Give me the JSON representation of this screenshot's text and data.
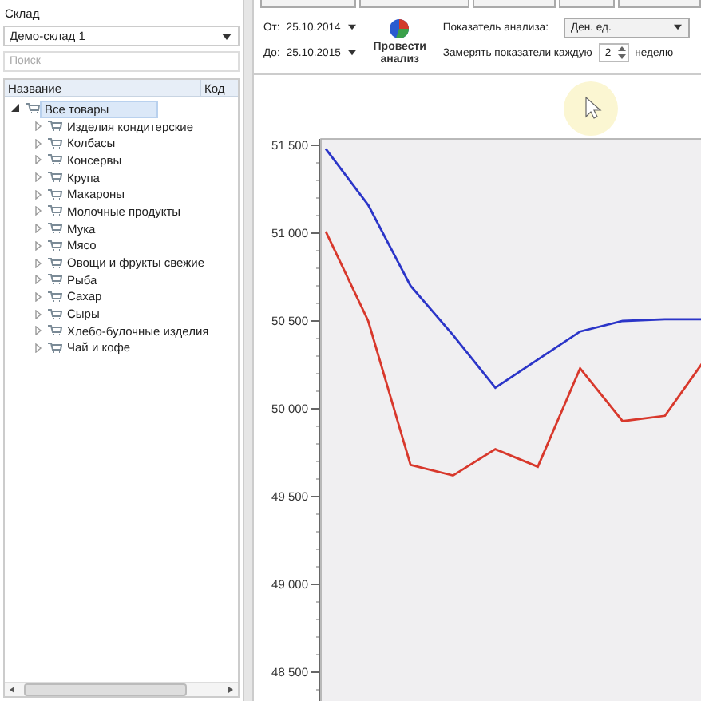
{
  "sidebar": {
    "warehouse_label": "Склад",
    "warehouse": "Демо-склад 1",
    "search": {
      "placeholder": "Поиск"
    },
    "columns": [
      "Название",
      "Код"
    ],
    "tree": [
      {
        "label": "Все товары",
        "expanded": true,
        "selected": true,
        "children": [
          {
            "label": "Изделия кондитерские",
            "expanded": false,
            "selected": false
          },
          {
            "label": "Колбасы",
            "expanded": false,
            "selected": false
          },
          {
            "label": "Консервы",
            "expanded": false,
            "selected": false
          },
          {
            "label": "Крупа",
            "expanded": false,
            "selected": false
          },
          {
            "label": "Макароны",
            "expanded": false,
            "selected": false
          },
          {
            "label": "Молочные продукты",
            "expanded": false,
            "selected": false
          },
          {
            "label": "Мука",
            "expanded": false,
            "selected": false
          },
          {
            "label": "Мясо",
            "expanded": false,
            "selected": false
          },
          {
            "label": "Овощи и фрукты свежие",
            "expanded": false,
            "selected": false
          },
          {
            "label": "Рыба",
            "expanded": false,
            "selected": false
          },
          {
            "label": "Сахар",
            "expanded": false,
            "selected": false
          },
          {
            "label": "Сыры",
            "expanded": false,
            "selected": false
          },
          {
            "label": "Хлебо-булочные изделия",
            "expanded": false,
            "selected": false
          },
          {
            "label": "Чай и кофе",
            "expanded": false,
            "selected": false
          }
        ]
      }
    ]
  },
  "toolbar": {
    "from_label": "От:",
    "from_date": "25.10.2014",
    "to_label": "До:",
    "to_date": "25.10.2015",
    "analyze_button": "Провести анализ",
    "indicator_label": "Показатель анализа:",
    "indicator": "Ден. ед.",
    "interval_label": "Замерять показатели каждую",
    "interval": "2",
    "interval_unit": "неделю"
  },
  "chart": {
    "chart_data": {
      "type": "line",
      "categories": [
        null,
        null,
        null,
        null,
        null,
        null,
        null,
        null,
        null,
        null
      ],
      "ylim": [
        48340,
        51550
      ],
      "yticks": [
        {
          "value": 48500,
          "label": "48 500"
        },
        {
          "value": 49000,
          "label": "49 000"
        },
        {
          "value": 49500,
          "label": "49 500"
        },
        {
          "value": 50000,
          "label": "50 000"
        },
        {
          "value": 50500,
          "label": "50 500"
        },
        {
          "value": 51000,
          "label": "51 000"
        },
        {
          "value": 51500,
          "label": "51 500"
        }
      ],
      "series": [
        {
          "color": "#2b35c8",
          "values": [
            51480,
            51160,
            50700,
            50420,
            50120,
            50280,
            50440,
            50500,
            50510,
            50510
          ]
        },
        {
          "color": "#d8382c",
          "values": [
            51010,
            50500,
            49680,
            49620,
            49770,
            49670,
            50230,
            49930,
            49960,
            50300
          ]
        }
      ]
    }
  }
}
